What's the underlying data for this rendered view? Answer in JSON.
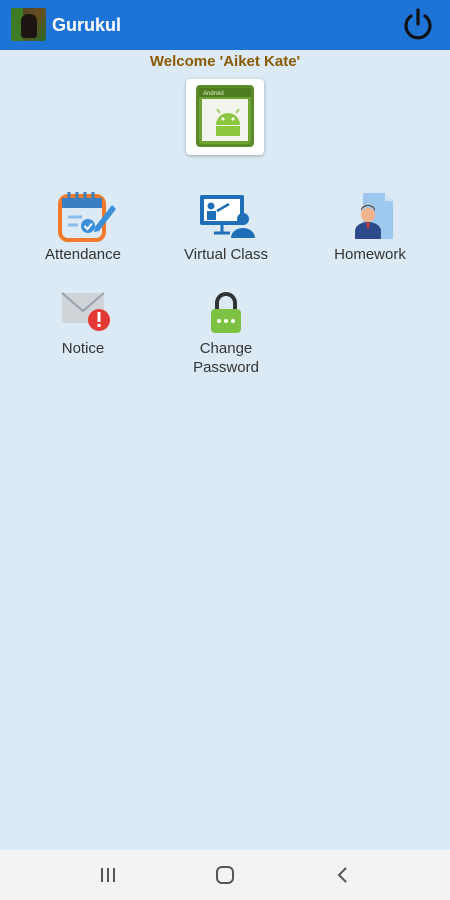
{
  "app": {
    "title": "Gurukul",
    "logo_icon": "profile-photo-icon",
    "power_icon": "power-icon",
    "colors": {
      "appbar": "#1e73d6",
      "background": "#dbeaf5",
      "welcome_text": "#8a5a00"
    }
  },
  "welcome": {
    "text": "Welcome  'Aiket Kate'"
  },
  "avatar": {
    "icon": "android-app-icon",
    "label": "Android"
  },
  "menu": [
    {
      "label": "Attendance",
      "icon": "attendance-calendar-icon"
    },
    {
      "label": "Virtual Class",
      "icon": "virtual-class-icon"
    },
    {
      "label": "Homework",
      "icon": "homework-icon"
    },
    {
      "label": "Notice",
      "icon": "notice-mail-icon"
    },
    {
      "label_line1": "Change",
      "label_line2": "Password",
      "icon": "lock-icon"
    }
  ],
  "navbar": {
    "icons": [
      "recent-apps-icon",
      "home-icon",
      "back-icon"
    ]
  }
}
